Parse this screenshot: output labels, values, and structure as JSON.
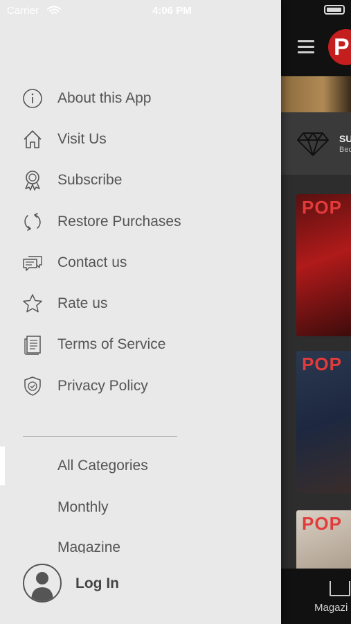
{
  "status_bar": {
    "carrier": "Carrier",
    "time": "4:06 PM"
  },
  "drawer": {
    "menu": [
      {
        "label": "About this App",
        "icon": "info-icon"
      },
      {
        "label": "Visit Us",
        "icon": "home-icon"
      },
      {
        "label": "Subscribe",
        "icon": "badge-icon"
      },
      {
        "label": "Restore Purchases",
        "icon": "refresh-icon"
      },
      {
        "label": "Contact us",
        "icon": "chat-icon"
      },
      {
        "label": "Rate us",
        "icon": "star-icon"
      },
      {
        "label": "Terms of Service",
        "icon": "document-icon"
      },
      {
        "label": "Privacy Policy",
        "icon": "shield-icon"
      }
    ],
    "categories": [
      "All Categories",
      "Monthly",
      "Magazine"
    ],
    "login_label": "Log In"
  },
  "background_app": {
    "logo_text": "P",
    "subscribe_title": "SU",
    "subscribe_subtitle": "Bec",
    "cover_masthead": "POP",
    "tab_label": "Magazi"
  },
  "colors": {
    "drawer_bg": "#e9e9e9",
    "text": "#555555",
    "brand_red": "#c51e1e",
    "dark_bg": "#2d2d2d"
  }
}
